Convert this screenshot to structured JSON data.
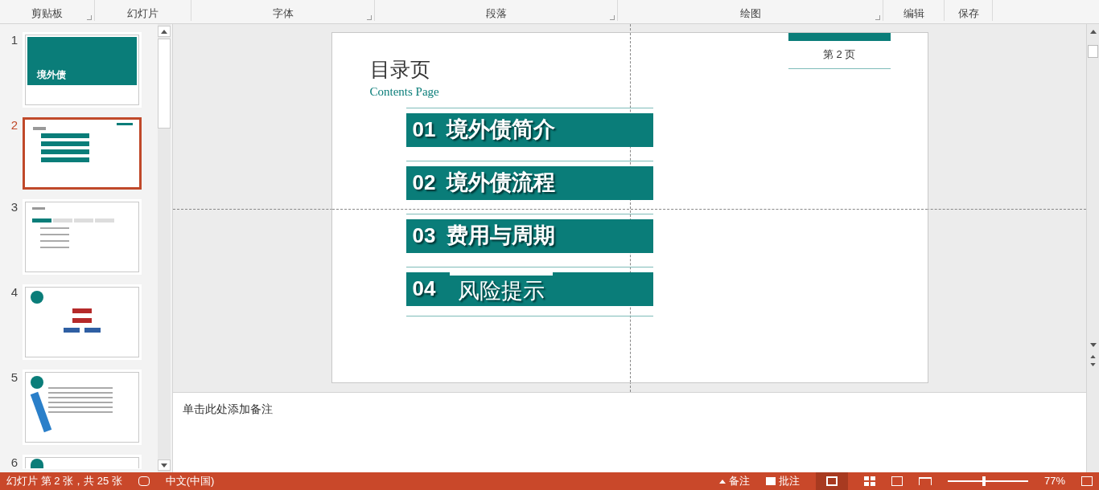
{
  "ribbon": {
    "groups": [
      {
        "label": "剪贴板",
        "launcher": true
      },
      {
        "label": "幻灯片",
        "launcher": false
      },
      {
        "label": "字体",
        "launcher": true
      },
      {
        "label": "段落",
        "launcher": true
      },
      {
        "label": "绘图",
        "launcher": true
      },
      {
        "label": "编辑",
        "launcher": false
      },
      {
        "label": "保存",
        "launcher": false
      }
    ]
  },
  "thumbnails": [
    {
      "number": "1",
      "kind": "title",
      "title": "境外债",
      "selected": false
    },
    {
      "number": "2",
      "kind": "toc",
      "selected": true
    },
    {
      "number": "3",
      "kind": "tabs",
      "selected": false
    },
    {
      "number": "4",
      "kind": "diagram",
      "selected": false
    },
    {
      "number": "5",
      "kind": "timeline",
      "selected": false
    },
    {
      "number": "6",
      "kind": "partial",
      "selected": false
    }
  ],
  "slide": {
    "title": "目录页",
    "subtitle": "Contents Page",
    "page_label": "第 2 页",
    "items": [
      {
        "number": "01",
        "title": "境外债简介",
        "kind": "bold"
      },
      {
        "number": "02",
        "title": "境外债流程",
        "kind": "bold"
      },
      {
        "number": "03",
        "title": "费用与周期",
        "kind": "bold"
      },
      {
        "number": "04",
        "title": "风险提示",
        "kind": "plain"
      }
    ]
  },
  "notes": {
    "placeholder": "单击此处添加备注"
  },
  "status_bar": {
    "slide_info": "幻灯片 第 2 张，共 25 张",
    "language": "中文(中国)",
    "notes": "备注",
    "comments": "批注",
    "zoom": "77%",
    "zoom_slider": {
      "level": 0.45
    }
  }
}
